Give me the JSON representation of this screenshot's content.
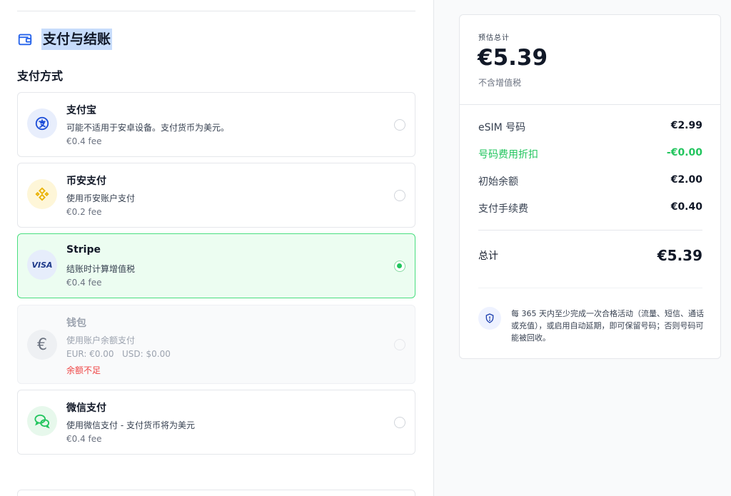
{
  "section": {
    "title": "支付与结账"
  },
  "payment_methods_title": "支付方式",
  "methods": [
    {
      "name": "支付宝",
      "desc": "可能不适用于安卓设备。支付货币为美元。",
      "fee": "€0.4 fee",
      "state": "unselected",
      "icon": "alipay-icon"
    },
    {
      "name": "币安支付",
      "desc": "使用币安账户支付",
      "fee": "€0.2 fee",
      "state": "unselected",
      "icon": "binance-icon"
    },
    {
      "name": "Stripe",
      "desc": "结账时计算增值税",
      "fee": "€0.4 fee",
      "state": "selected",
      "icon": "visa-icon",
      "icon_text": "VISA"
    },
    {
      "name": "钱包",
      "desc": "使用账户余额支付",
      "balance_eur": "EUR: €0.00",
      "balance_usd": "USD: $0.00",
      "warning": "余额不足",
      "state": "disabled",
      "icon": "euro-icon",
      "icon_text": "€"
    },
    {
      "name": "微信支付",
      "desc": "使用微信支付 - 支付货币将为美元",
      "fee": "€0.4 fee",
      "state": "unselected",
      "icon": "wechat-icon"
    }
  ],
  "summary": {
    "label": "预估总计",
    "total": "€5.39",
    "note": "不含增值税",
    "rows": [
      {
        "label": "eSIM 号码",
        "value": "€2.99"
      },
      {
        "label": "号码费用折扣",
        "value": "-€0.00"
      },
      {
        "label": "初始余额",
        "value": "€2.00"
      },
      {
        "label": "支付手续费",
        "value": "€0.40"
      }
    ],
    "total_label": "总计",
    "total_value": "€5.39",
    "notice": "每 365 天内至少完成一次合格活动（流量、短信、通话或充值），或启用自动延期，即可保留号码；否则号码可能被回收。"
  },
  "colors": {
    "accent_green": "#22c55e",
    "selected_bg": "#ecfdf1",
    "highlight": "#c7dcfb",
    "warning": "#ef4444"
  }
}
